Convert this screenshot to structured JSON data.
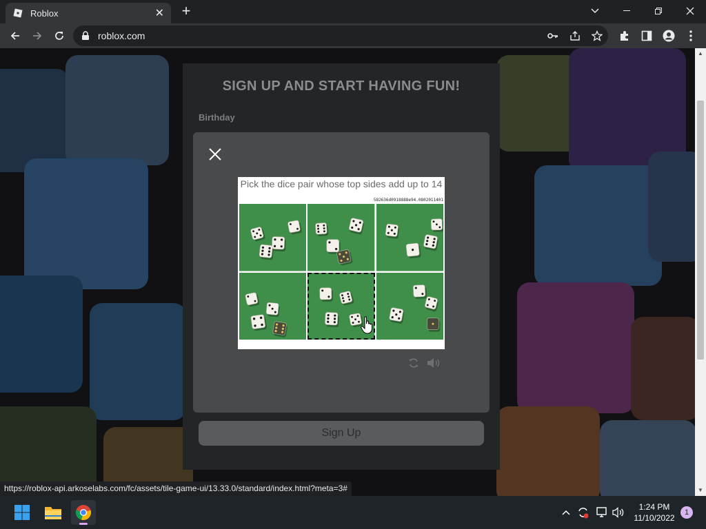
{
  "browser": {
    "tab_title": "Roblox",
    "address": "roblox.com",
    "status_url": "https://roblox-api.arkoselabs.com/fc/assets/tile-game-ui/13.33.0/standard/index.html?meta=3#"
  },
  "signup": {
    "title": "SIGN UP AND START HAVING FUN!",
    "birthday_label": "Birthday",
    "button_label": "Sign Up"
  },
  "captcha": {
    "prompt": "Pick the dice pair whose top sides add up to 14",
    "hash": "582636d0918888e94.0802011401",
    "tiles": [
      {
        "label": "dice-option-1"
      },
      {
        "label": "dice-option-2"
      },
      {
        "label": "dice-option-3"
      },
      {
        "label": "dice-option-4"
      },
      {
        "label": "dice-option-5"
      },
      {
        "label": "dice-option-6"
      }
    ],
    "hovered_tile": 5
  },
  "taskbar": {
    "time": "1:24 PM",
    "date": "11/10/2022",
    "notification_count": "1"
  },
  "icons": {
    "favicon": "roblox-logo-icon",
    "back": "arrow-left-icon",
    "forward": "arrow-right-icon",
    "reload": "reload-icon",
    "lock": "lock-icon",
    "key": "key-icon",
    "share": "share-icon",
    "star": "star-icon",
    "extensions": "puzzle-icon",
    "sidepanel": "side-panel-icon",
    "profile": "person-icon",
    "menu": "kebab-menu-icon",
    "captcha_reload": "refresh-icon",
    "captcha_audio": "speaker-icon"
  },
  "colors": {
    "chrome_dark": "#202124",
    "chrome_toolbar": "#35363a",
    "modal_bg": "#494a4b",
    "card_bg": "#232527",
    "grass": "#3f8f4a"
  }
}
